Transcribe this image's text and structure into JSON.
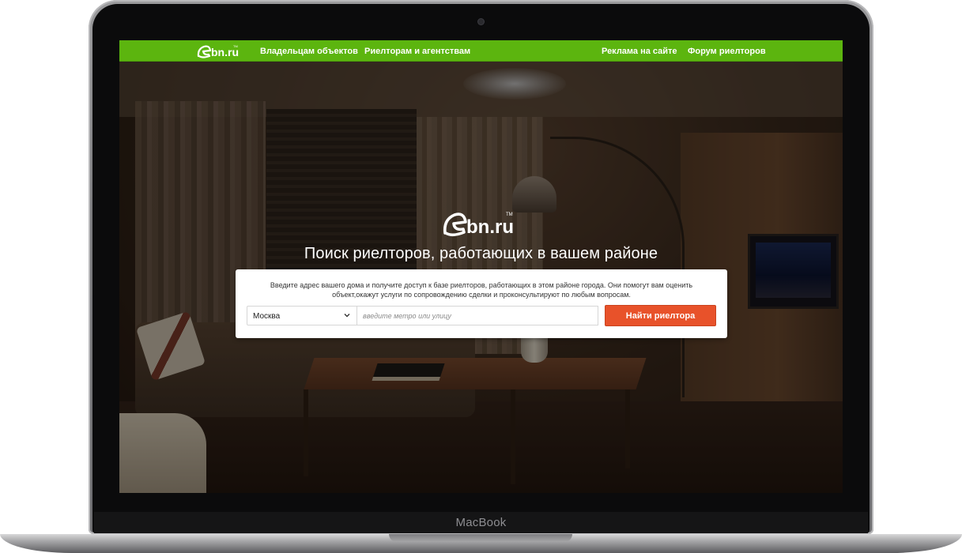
{
  "brand": {
    "logo_e": "e",
    "logo_text": "bn.ru",
    "trademark": "TM",
    "accent_color": "#5cb50f",
    "button_color": "#e8522a"
  },
  "nav": {
    "items": [
      {
        "label": "Владельцам объектов"
      },
      {
        "label": "Риелторам и агентствам"
      },
      {
        "label": "Реклама на сайте"
      },
      {
        "label": "Форум риелторов"
      }
    ]
  },
  "hero": {
    "title": "Поиск риелторов, работающих в вашем районе"
  },
  "search": {
    "description": "Введите адрес вашего дома и получите доступ к базе риелторов, работающих в этом районе города. Они помогут вам оценить объект,окажут услуги по сопровождению сделки и проконсультируют по любым вопросам.",
    "city_value": "Москва",
    "address_placeholder": "введите метро или улицу",
    "submit_label": "Найти риелтора"
  },
  "device": {
    "label": "MacBook"
  },
  "icons": [
    "logo-house-e-icon",
    "chevron-down-icon",
    "camera-icon"
  ]
}
